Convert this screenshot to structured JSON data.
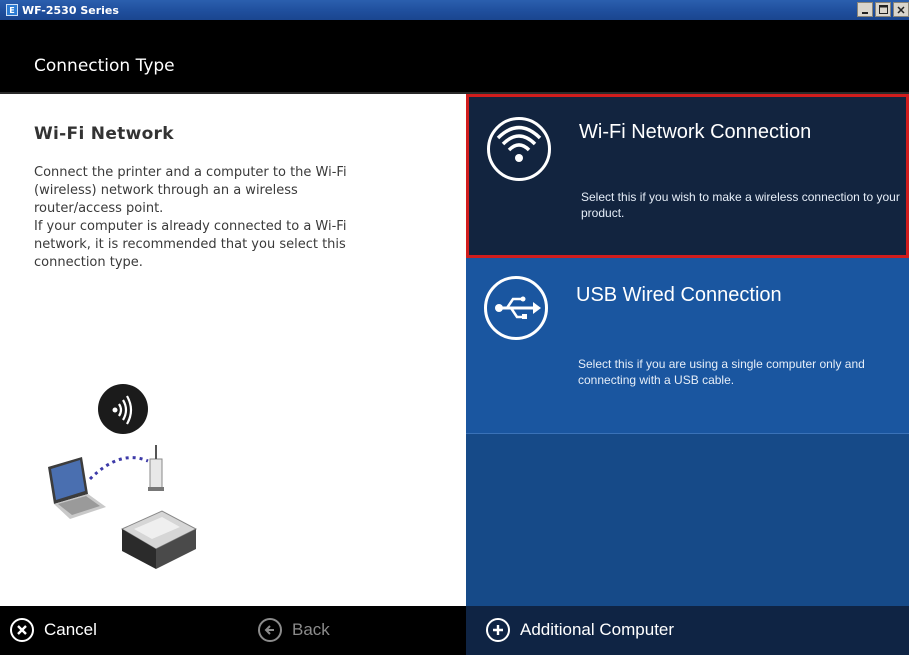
{
  "window": {
    "title": "WF-2530 Series",
    "app_icon_letter": "E"
  },
  "header": {
    "title": "Connection Type"
  },
  "description": {
    "title": "Wi-Fi Network",
    "text": "Connect the printer and a computer to the Wi-Fi\n(wireless) network through an a wireless\nrouter/access point.\nIf your computer is already connected to a Wi-Fi\nnetwork, it is recommended that you select this\nconnection type."
  },
  "options": {
    "wifi": {
      "title": "Wi-Fi Network Connection",
      "desc": "Select this if you wish to make a wireless connection to your product.",
      "icon": "wifi-icon",
      "selected": true
    },
    "usb": {
      "title": "USB Wired Connection",
      "desc": "Select this if you are using a single computer only and connecting with a USB cable.",
      "icon": "usb-icon"
    }
  },
  "footer": {
    "cancel_label": "Cancel",
    "back_label": "Back",
    "additional_label": "Additional Computer"
  },
  "colors": {
    "selected_border": "#d01d1d",
    "option_blue": "#1a56a0",
    "option_dark": "#12243f"
  }
}
